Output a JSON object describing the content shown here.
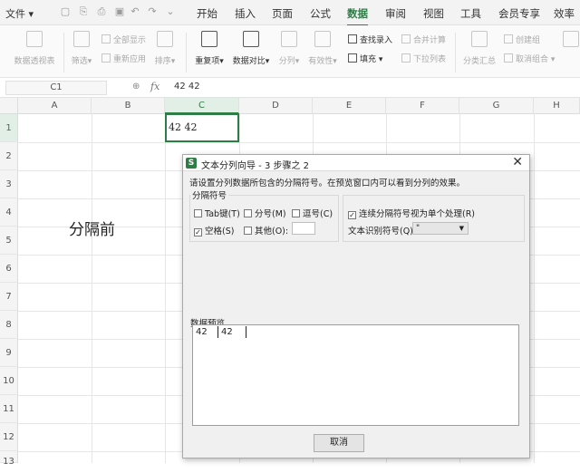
{
  "menubar": {
    "file_label": "文件",
    "tabs": [
      "开始",
      "插入",
      "页面",
      "公式",
      "数据",
      "审阅",
      "视图",
      "工具",
      "会员专享",
      "效率"
    ],
    "active_tab": "数据"
  },
  "ribbon": {
    "pivot": "数据透视表",
    "filter": "筛选",
    "show_all": "全部显示",
    "reapply": "重新应用",
    "sort": "排序",
    "duplicates": "重复项",
    "compare": "数据对比",
    "split": "分列",
    "validity": "有效性",
    "find_entry": "查找录入",
    "fill": "填充",
    "merge_calc": "合并计算",
    "dropdown_list": "下拉列表",
    "subtotal": "分类汇总",
    "create_group": "创建组",
    "ungroup": "取消组合"
  },
  "formula_bar": {
    "cell_ref": "C1",
    "fx": "fx",
    "content": "42 42"
  },
  "sheet": {
    "columns": [
      "A",
      "B",
      "C",
      "D",
      "E",
      "F",
      "G",
      "H"
    ],
    "rows": [
      "1",
      "2",
      "3",
      "4",
      "5",
      "6",
      "7",
      "8",
      "9",
      "10",
      "11",
      "12",
      "13"
    ],
    "c1_value": "42 42",
    "note_text": "分隔前"
  },
  "dialog": {
    "title": "文本分列向导 - 3 步骤之 2",
    "instruction": "请设置分列数据所包含的分隔符号。在预览窗口内可以看到分列的效果。",
    "separator_group": "分隔符号",
    "tab_label": "Tab键(T)",
    "semicolon_label": "分号(M)",
    "comma_label": "逗号(C)",
    "space_label": "空格(S)",
    "other_label": "其他(O):",
    "consecutive_label": "连续分隔符号视为单个处理(R)",
    "qualifier_label": "文本识别符号(Q):",
    "qualifier_value": "\"",
    "preview_label": "数据预览",
    "preview_col1": "42",
    "preview_col2": "42",
    "cancel_label": "取消"
  }
}
